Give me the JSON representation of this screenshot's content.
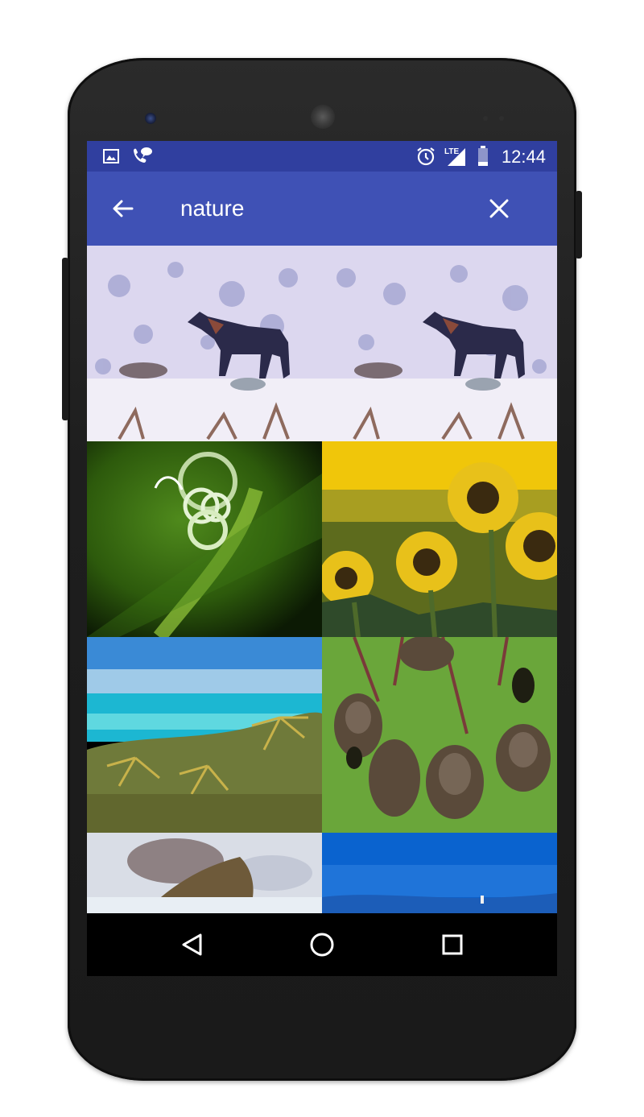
{
  "status_bar": {
    "time": "12:44",
    "left_icons": [
      "image-notification-icon",
      "phone-message-icon"
    ],
    "right_icons": [
      "alarm-icon",
      "lte-signal-icon",
      "battery-icon"
    ]
  },
  "app_bar": {
    "back_icon": "arrow-back-icon",
    "search_value": "nature",
    "clear_icon": "close-icon",
    "background": "#3f51b5",
    "status_background": "#303f9f"
  },
  "results": [
    {
      "subject": "wolf-in-snow"
    },
    {
      "subject": "wolf-in-snow"
    },
    {
      "subject": "green-spiral-tendril"
    },
    {
      "subject": "sunflower-field"
    },
    {
      "subject": "tropical-beach-palms"
    },
    {
      "subject": "weaver-bird-nests"
    },
    {
      "subject": "rocky-cliff-clouds"
    },
    {
      "subject": "blue-ocean-horizon"
    }
  ],
  "nav_bar": {
    "icons": [
      "back-triangle-icon",
      "home-circle-icon",
      "recents-square-icon"
    ]
  }
}
